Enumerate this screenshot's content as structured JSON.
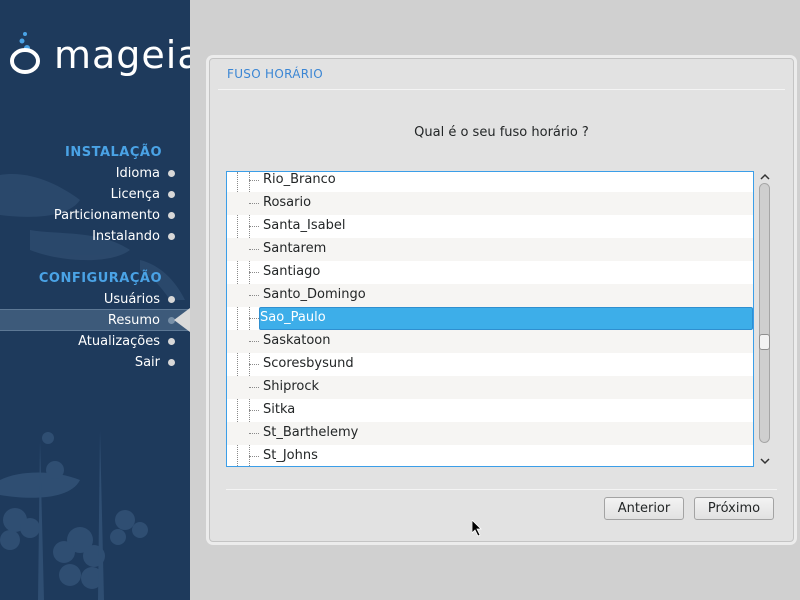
{
  "app": {
    "logo_text": "mageia",
    "brand_color": "#4aa3e6",
    "sidebar_color": "#1e3a5c"
  },
  "sidebar": {
    "sections": [
      {
        "title": "INSTALAÇÃO",
        "items": [
          {
            "label": "Idioma"
          },
          {
            "label": "Licença"
          },
          {
            "label": "Particionamento"
          },
          {
            "label": "Instalando"
          }
        ]
      },
      {
        "title": "CONFIGURAÇÃO",
        "items": [
          {
            "label": "Usuários"
          },
          {
            "label": "Resumo",
            "active": true
          },
          {
            "label": "Atualizações"
          },
          {
            "label": "Sair"
          }
        ]
      }
    ]
  },
  "panel": {
    "title": "FUSO HORÁRIO",
    "question": "Qual é o seu fuso horário ?",
    "timezones": [
      "Rio_Branco",
      "Rosario",
      "Santa_Isabel",
      "Santarem",
      "Santiago",
      "Santo_Domingo",
      "Sao_Paulo",
      "Saskatoon",
      "Scoresbysund",
      "Shiprock",
      "Sitka",
      "St_Barthelemy",
      "St_Johns"
    ],
    "selected": "Sao_Paulo",
    "scroll_position": 0.62,
    "buttons": {
      "previous": "Anterior",
      "next": "Próximo"
    }
  },
  "icons": {
    "scroll_up": "chevron-up-icon",
    "scroll_down": "chevron-down-icon",
    "cursor": "mouse-pointer-icon"
  }
}
